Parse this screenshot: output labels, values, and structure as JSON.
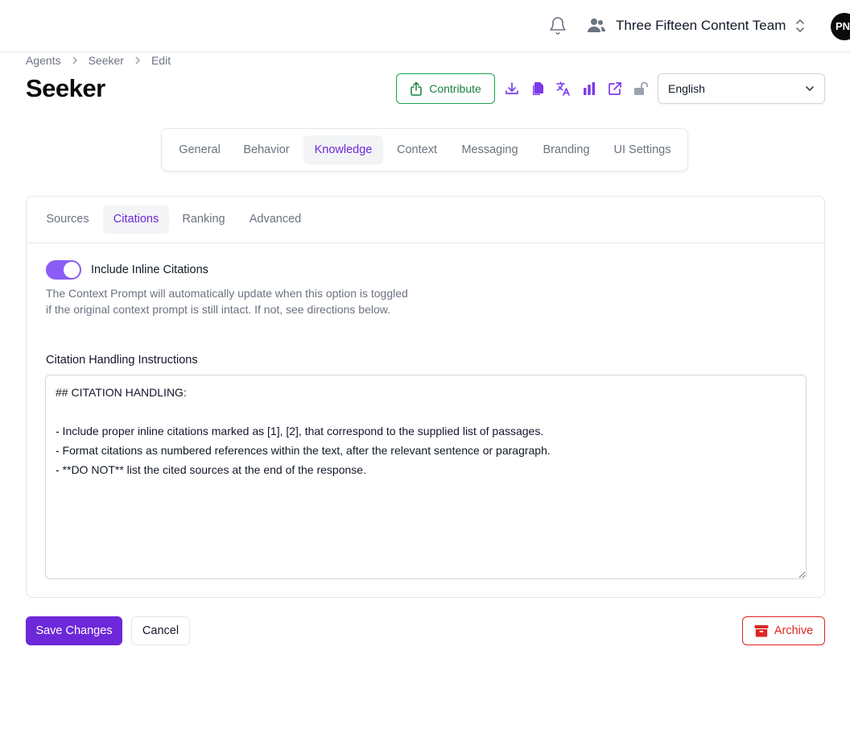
{
  "header": {
    "team_name": "Three Fifteen Content Team",
    "avatar_initials": "PN"
  },
  "breadcrumb": [
    "Agents",
    "Seeker",
    "Edit"
  ],
  "page": {
    "title": "Seeker"
  },
  "toolbar": {
    "contribute_label": "Contribute",
    "icons": [
      "download-icon",
      "copy-icon",
      "translate-icon",
      "analytics-icon",
      "external-link-icon",
      "unlock-icon"
    ],
    "language": "English"
  },
  "tabs": [
    {
      "label": "General"
    },
    {
      "label": "Behavior"
    },
    {
      "label": "Knowledge",
      "active": true
    },
    {
      "label": "Context"
    },
    {
      "label": "Messaging"
    },
    {
      "label": "Branding"
    },
    {
      "label": "UI Settings"
    }
  ],
  "subtabs": [
    {
      "label": "Sources"
    },
    {
      "label": "Citations",
      "active": true
    },
    {
      "label": "Ranking"
    },
    {
      "label": "Advanced"
    }
  ],
  "citations": {
    "toggle_label": "Include Inline Citations",
    "toggle_on": true,
    "help_text": "The Context Prompt will automatically update when this option is toggled if the original context prompt is still intact. If not, see directions below.",
    "field_label": "Citation Handling Instructions",
    "instructions": "## CITATION HANDLING:\n\n- Include proper inline citations marked as [1], [2], that correspond to the supplied list of passages.\n- Format citations as numbered references within the text, after the relevant sentence or paragraph.\n- **DO NOT** list the cited sources at the end of the response."
  },
  "actions": {
    "save_label": "Save Changes",
    "cancel_label": "Cancel",
    "archive_label": "Archive"
  },
  "colors": {
    "accent": "#6d28d9",
    "toggle": "#8b5cf6",
    "contribute": "#16a34a",
    "danger": "#dc2626"
  }
}
